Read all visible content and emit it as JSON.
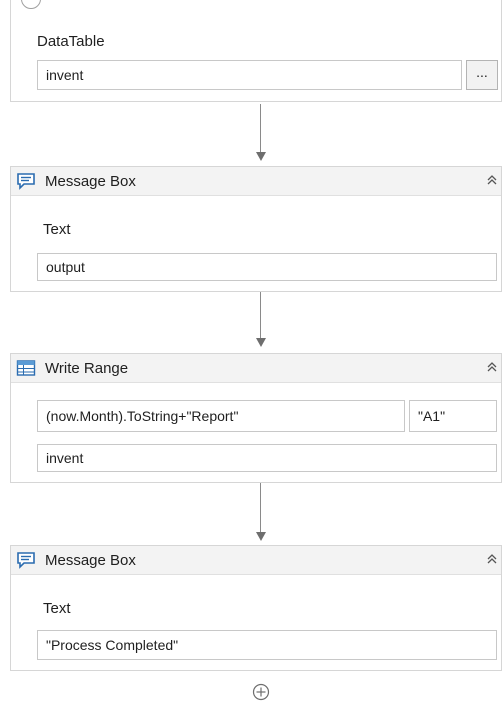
{
  "activities": [
    {
      "title": "",
      "field_label": "DataTable",
      "field_value": "invent",
      "button_label": "..."
    },
    {
      "title": "Message Box",
      "field_label": "Text",
      "field_value": "output"
    },
    {
      "title": "Write Range",
      "sheet_value": "(now.Month).ToString+\"Report\"",
      "cell_value": "\"A1\"",
      "datatable_value": "invent"
    },
    {
      "title": "Message Box",
      "field_label": "Text",
      "field_value": "\"Process Completed\""
    }
  ],
  "icons": {
    "message_box": "message-box-icon",
    "write_range": "write-range-icon",
    "collapse": "collapse-chevrons-icon",
    "add": "add-activity-icon"
  },
  "colors": {
    "accent": "#2b6cb0",
    "header_bg": "#f3f3f3",
    "border": "#d6d6d6"
  }
}
